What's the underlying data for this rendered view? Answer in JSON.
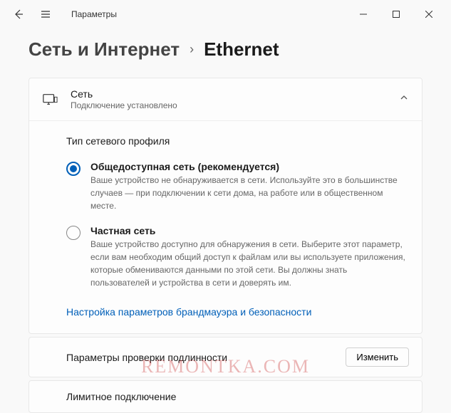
{
  "app": {
    "title": "Параметры"
  },
  "breadcrumb": {
    "parent": "Сеть и Интернет",
    "current": "Ethernet"
  },
  "network": {
    "title": "Сеть",
    "status": "Подключение установлено",
    "profile_label": "Тип сетевого профиля",
    "public": {
      "title": "Общедоступная сеть (рекомендуется)",
      "desc": "Ваше устройство не обнаруживается в сети. Используйте это в большинстве случаев — при подключении к сети дома, на работе или в общественном месте."
    },
    "private": {
      "title": "Частная сеть",
      "desc": "Ваше устройство доступно для обнаружения в сети. Выберите этот параметр, если вам необходим общий доступ к файлам или вы используете приложения, которые обмениваются данными по этой сети. Вы должны знать пользователей и устройства в сети и доверять им."
    },
    "firewall_link": "Настройка параметров брандмауэра и безопасности"
  },
  "auth_row": {
    "title": "Параметры проверки подлинности",
    "button": "Изменить"
  },
  "limit_row": {
    "title": "Лимитное подключение"
  },
  "watermark": "REMONTKA.COM"
}
